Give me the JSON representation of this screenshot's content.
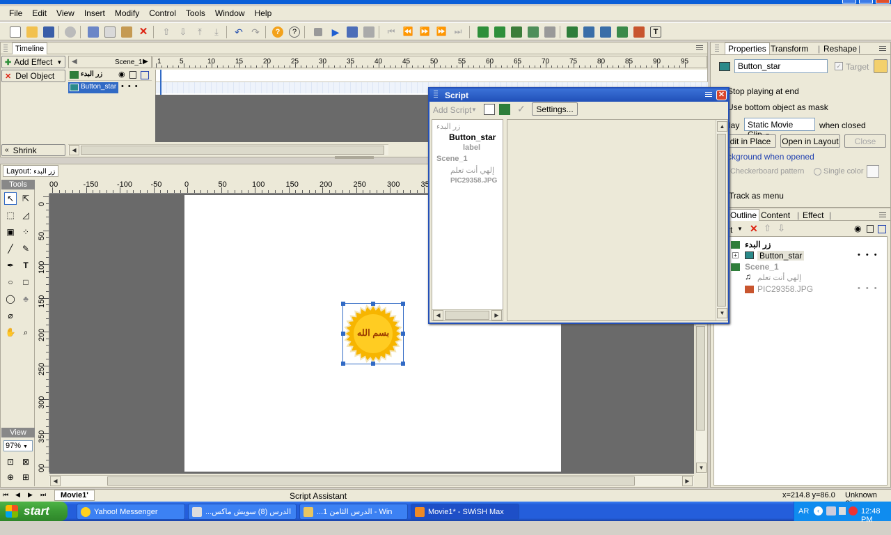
{
  "menu": [
    "File",
    "Edit",
    "View",
    "Insert",
    "Modify",
    "Control",
    "Tools",
    "Window",
    "Help"
  ],
  "timeline": {
    "tab": "Timeline",
    "add_effect": "Add Effect",
    "del_object": "Del Object",
    "shrink": "Shrink",
    "scene_label": "Scene_1",
    "rows": [
      "زر البدء",
      "Button_star"
    ],
    "frame_numbers": [
      "1",
      "5",
      "10",
      "15",
      "20",
      "25",
      "30",
      "35",
      "40",
      "45",
      "50",
      "55",
      "60",
      "65",
      "70",
      "75",
      "80",
      "85",
      "90",
      "95"
    ]
  },
  "layout": {
    "tab": "Layout:",
    "tab_name": "زر البدء",
    "ruler_h": [
      "00",
      "-150",
      "-100",
      "-50",
      "0",
      "50",
      "100",
      "150",
      "200",
      "250",
      "300",
      "350"
    ],
    "ruler_v": [
      "0",
      "50",
      "100",
      "150",
      "200",
      "250",
      "300",
      "350",
      "400"
    ],
    "button_text": "بسم الله"
  },
  "tools": {
    "header": "Tools",
    "view_header": "View",
    "zoom": "97%"
  },
  "script": {
    "title": "Script",
    "add_script": "Add Script",
    "settings": "Settings...",
    "tree": [
      "زر البدء",
      "Button_star",
      "label",
      "Scene_1",
      "إلهي أنت تعلم",
      "PIC29358.JPG"
    ]
  },
  "properties": {
    "tabs": [
      "Properties",
      "Transform",
      "Reshape"
    ],
    "name_value": "Button_star",
    "target_label": "Target",
    "stop_at_end": "Stop playing at end",
    "bottom_mask": "Use bottom object as mask",
    "play_prefix": "lay",
    "play_select": "Static Movie Clip",
    "when_closed": "when closed",
    "edit_in_place": "dit in Place",
    "open_in_layout": "Open in Layout",
    "close": "Close",
    "bg_when_opened": "ckground when opened",
    "checkerboard": "Checkerboard pattern",
    "single_color": "Single color",
    "track_menu": "Track as menu"
  },
  "outline": {
    "tabs": [
      "Outline",
      "Content",
      "Effect"
    ],
    "partial_label": "rt",
    "items": [
      "زر البدء",
      "Button_star",
      "Scene_1",
      "إلهي أنت تعلم",
      "PIC29358.JPG"
    ]
  },
  "status": {
    "movie_tab": "Movie1'",
    "assistant": "Script Assistant",
    "coords": "x=214.8 y=86.0",
    "size": "Unknown Size"
  },
  "taskbar": {
    "start": "start",
    "tasks": [
      "Yahoo! Messenger",
      "...الدرس (8) سويش ماكس",
      "...الدرس الثامن 1 - Win",
      "Movie1* - SWiSH Max"
    ],
    "lang": "AR",
    "time": "12:48 PM"
  },
  "colors": {
    "accent": "#316ac5",
    "selected_bg": "#316ac5",
    "star": "#f7b500"
  }
}
